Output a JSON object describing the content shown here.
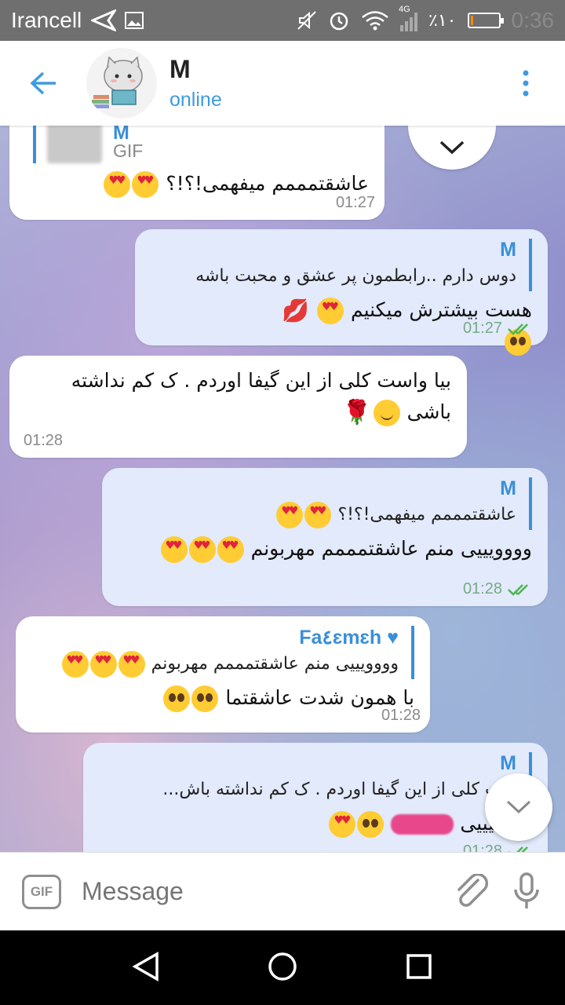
{
  "status_bar": {
    "carrier": "Irancell",
    "network": "4G",
    "battery_text": "٪۱۰",
    "battery_level": 0.1,
    "time": "0:36",
    "colors": {
      "battery": "#ff8a00"
    }
  },
  "header": {
    "name": "M",
    "status": "online",
    "icons": {
      "back": "back-arrow-icon",
      "menu": "more-vertical-icon"
    },
    "accent": "#3d9be0"
  },
  "messages": [
    {
      "reply_name": "M",
      "reply_media": "GIF",
      "text": "عاشقتمممم میفهمی!؟!؟",
      "time": "01:27"
    },
    {
      "reply_name": "M",
      "reply_text": "دوس دارم ..رابطمون پر عشق و محبت باشه",
      "text": "هست بیشترش میکنیم",
      "time": "01:27"
    },
    {
      "text": "بیا واست کلی از این گیفا اوردم . ک کم نداشته باشی",
      "time": "01:28"
    },
    {
      "reply_name": "M",
      "reply_text": "عاشقتمممم میفهمی!؟!؟",
      "text": "وووویییی منم عاشقتمممم مهربونم",
      "time": "01:28"
    },
    {
      "reply_name": "Fa٤ɛmɛh ♥",
      "reply_text": "وووویییی منم عاشقتمممم مهربونم",
      "text": "با همون شدت عاشقتما",
      "time": "01:28"
    },
    {
      "reply_name": "M",
      "reply_text": "ست کلی از این گیفا اوردم . ک کم نداشته باش...",
      "text": "مرسیییی",
      "time": "01:28"
    }
  ],
  "input": {
    "gif_label": "GIF",
    "placeholder": "Message",
    "icons": {
      "attach": "paperclip-icon",
      "mic": "microphone-icon"
    }
  },
  "nav": {
    "icons": [
      "back-triangle-icon",
      "home-circle-icon",
      "recents-square-icon"
    ]
  }
}
